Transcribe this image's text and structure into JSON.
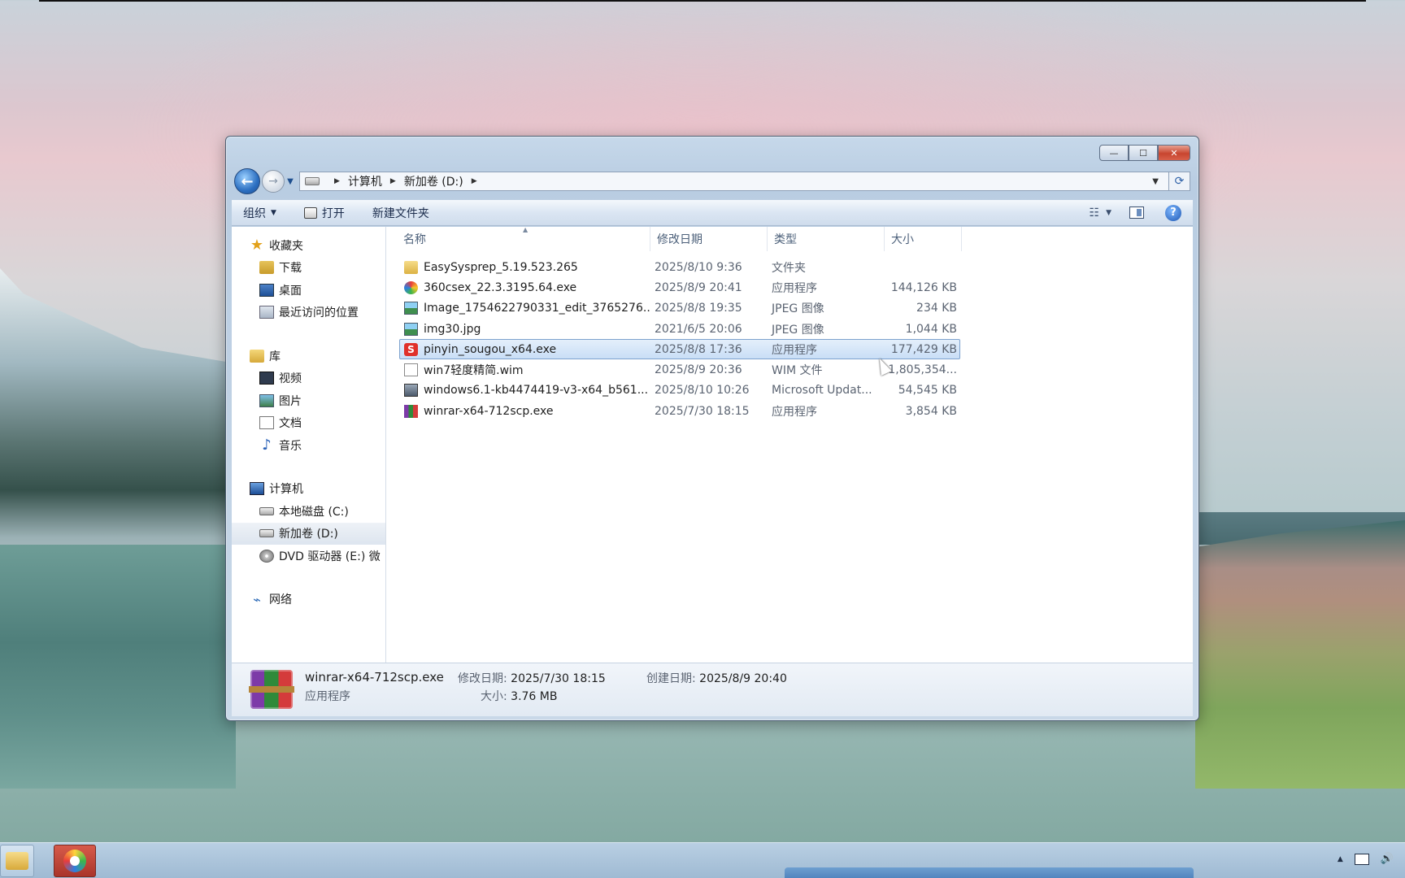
{
  "window": {
    "controls": {
      "minimize": "—",
      "maximize": "☐",
      "close": "✕"
    }
  },
  "address": {
    "crumbs": [
      "计算机",
      "新加卷 (D:)"
    ]
  },
  "toolbar": {
    "organize_label": "组织",
    "open_label": "打开",
    "new_folder_label": "新建文件夹"
  },
  "nav": {
    "favorites": {
      "label": "收藏夹",
      "items": [
        "下载",
        "桌面",
        "最近访问的位置"
      ]
    },
    "libraries": {
      "label": "库",
      "items": [
        "视频",
        "图片",
        "文档",
        "音乐"
      ]
    },
    "computer": {
      "label": "计算机",
      "items": [
        "本地磁盘 (C:)",
        "新加卷 (D:)",
        "DVD 驱动器 (E:) 微"
      ]
    },
    "network": {
      "label": "网络"
    }
  },
  "columns": {
    "name": "名称",
    "date": "修改日期",
    "type": "类型",
    "size": "大小"
  },
  "files": [
    {
      "name": "EasySysprep_5.19.523.265",
      "date": "2025/8/10 9:36",
      "type": "文件夹",
      "size": "",
      "icon": "folder-icon"
    },
    {
      "name": "360csex_22.3.3195.64.exe",
      "date": "2025/8/9 20:41",
      "type": "应用程序",
      "size": "144,126 KB",
      "icon": "360-browser-icon"
    },
    {
      "name": "Image_1754622790331_edit_3765276...",
      "date": "2025/8/8 19:35",
      "type": "JPEG 图像",
      "size": "234 KB",
      "icon": "image-file-icon"
    },
    {
      "name": "img30.jpg",
      "date": "2021/6/5 20:06",
      "type": "JPEG 图像",
      "size": "1,044 KB",
      "icon": "image-file-icon"
    },
    {
      "name": "pinyin_sougou_x64.exe",
      "date": "2025/8/8 17:36",
      "type": "应用程序",
      "size": "177,429 KB",
      "icon": "sogou-icon"
    },
    {
      "name": "win7轻度精简.wim",
      "date": "2025/8/9 20:36",
      "type": "WIM 文件",
      "size": "1,805,354...",
      "icon": "blank-file-icon"
    },
    {
      "name": "windows6.1-kb4474419-v3-x64_b561...",
      "date": "2025/8/10 10:26",
      "type": "Microsoft Updat...",
      "size": "54,545 KB",
      "icon": "update-package-icon"
    },
    {
      "name": "winrar-x64-712scp.exe",
      "date": "2025/7/30 18:15",
      "type": "应用程序",
      "size": "3,854 KB",
      "icon": "winrar-icon"
    }
  ],
  "details": {
    "name": "winrar-x64-712scp.exe",
    "kind": "应用程序",
    "modified_label": "修改日期:",
    "modified_value": "2025/7/30 18:15",
    "size_label": "大小:",
    "size_value": "3.76 MB",
    "created_label": "创建日期:",
    "created_value": "2025/8/9 20:40"
  },
  "colors": {
    "accent": "#2c6fc1",
    "selection": "#c9def6",
    "close": "#c8452f"
  }
}
